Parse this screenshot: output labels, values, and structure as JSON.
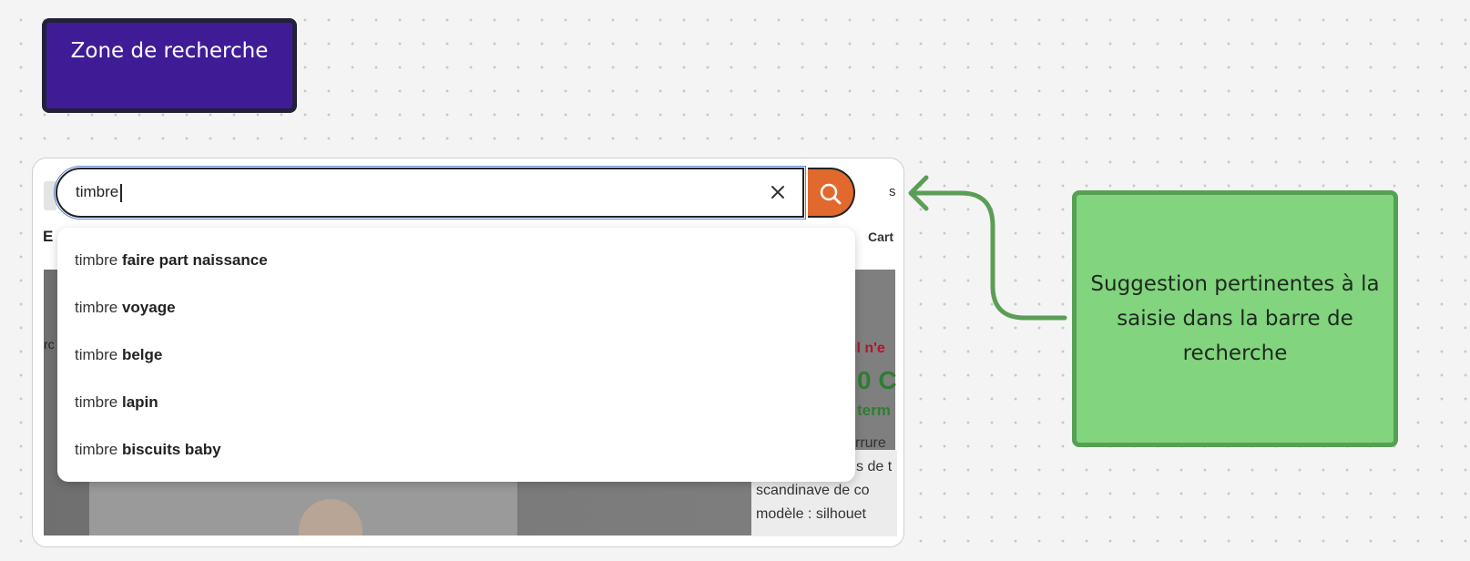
{
  "sticky_note": {
    "label": "Zone de recherche"
  },
  "search": {
    "value": "timbre",
    "clear_icon": "close-icon",
    "submit_icon": "search-icon",
    "accent_color": "#e2692d"
  },
  "suggestions": [
    {
      "prefix": "timbre ",
      "completion": "faire part naissance"
    },
    {
      "prefix": "timbre ",
      "completion": "voyage"
    },
    {
      "prefix": "timbre ",
      "completion": "belge"
    },
    {
      "prefix": "timbre ",
      "completion": "lapin"
    },
    {
      "prefix": "timbre ",
      "completion": "biscuits baby"
    }
  ],
  "background_fragments": {
    "top_right_partial": "s",
    "cart_label": "Cart",
    "left_logo_partial": "E",
    "left_text_partial": "rc",
    "promo_partial": "il n'e",
    "promo_big_partial": "0 C",
    "promo_sub_partial": "term",
    "desc_line_1": "rrure",
    "desc_line_2": "s de t",
    "desc_line_3": "scandinave de co",
    "desc_line_4": "modèle : silhouet"
  },
  "callout": {
    "text": "Suggestion pertinentes à la saisie dans la barre de recherche"
  },
  "colors": {
    "sticky_purple": "#3f1c96",
    "callout_green": "#82d47e",
    "connector_green": "#5a9e56",
    "promo_red": "#b2132e",
    "promo_green": "#2f7d34"
  }
}
